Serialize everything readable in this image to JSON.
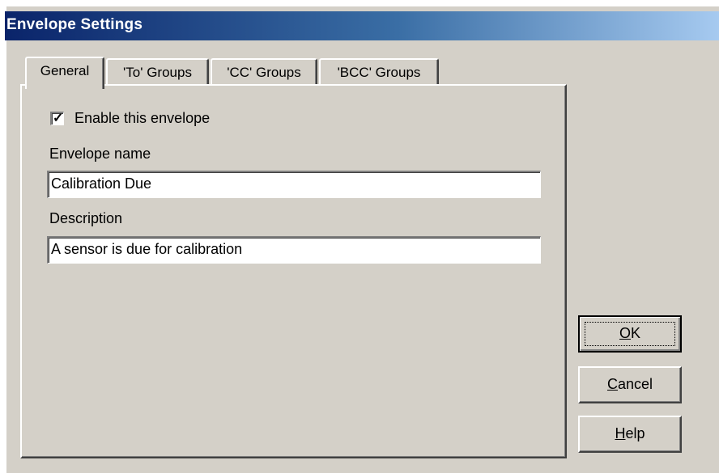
{
  "window": {
    "title": "Envelope Settings"
  },
  "tabs": [
    {
      "label": "General",
      "active": true
    },
    {
      "label": "'To' Groups",
      "active": false
    },
    {
      "label": "'CC' Groups",
      "active": false
    },
    {
      "label": "'BCC' Groups",
      "active": false
    }
  ],
  "general": {
    "enable_checkbox": {
      "label": "Enable this envelope",
      "checked": true
    },
    "envelope_name": {
      "label": "Envelope name",
      "value": "Calibration Due"
    },
    "description": {
      "label": "Description",
      "value": "A sensor is due for calibration"
    }
  },
  "buttons": {
    "ok": {
      "mnemonic": "O",
      "rest": "K"
    },
    "cancel": {
      "mnemonic": "C",
      "rest": "ancel"
    },
    "help": {
      "mnemonic": "H",
      "rest": "elp"
    }
  },
  "colors": {
    "face": "#d4d0c8",
    "titlebar_start": "#0a246a",
    "titlebar_end": "#a6caf0"
  }
}
